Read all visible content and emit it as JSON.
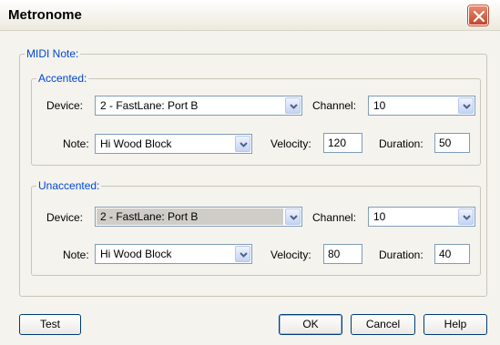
{
  "window": {
    "title": "Metronome"
  },
  "midi_note": {
    "legend": "MIDI Note:",
    "accented": {
      "legend": "Accented:",
      "device_label": "Device:",
      "device_value": "2 - FastLane: Port B",
      "channel_label": "Channel:",
      "channel_value": "10",
      "note_label": "Note:",
      "note_value": "Hi Wood Block",
      "velocity_label": "Velocity:",
      "velocity_value": "120",
      "duration_label": "Duration:",
      "duration_value": "50"
    },
    "unaccented": {
      "legend": "Unaccented:",
      "device_label": "Device:",
      "device_value": "2 - FastLane: Port B",
      "channel_label": "Channel:",
      "channel_value": "10",
      "note_label": "Note:",
      "note_value": "Hi Wood Block",
      "velocity_label": "Velocity:",
      "velocity_value": "80",
      "duration_label": "Duration:",
      "duration_value": "40"
    }
  },
  "buttons": {
    "test": "Test",
    "ok": "OK",
    "cancel": "Cancel",
    "help": "Help"
  }
}
